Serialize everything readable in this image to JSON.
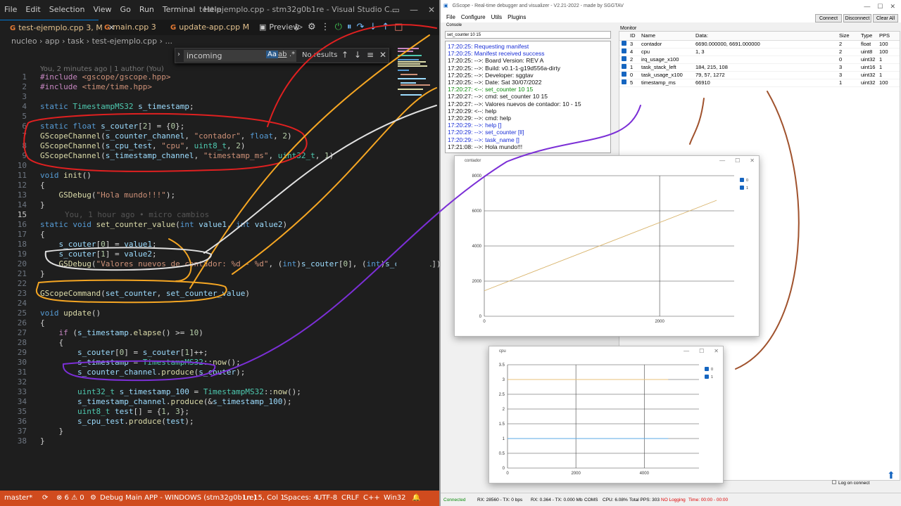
{
  "vscode": {
    "menu": [
      "File",
      "Edit",
      "Selection",
      "View",
      "Go",
      "Run",
      "Terminal",
      "Help"
    ],
    "title": "test-ejemplo.cpp - stm32g0b1re - Visual Studio C...",
    "tabs": [
      {
        "label": "test-ejemplo.cpp 3, M",
        "active": true
      },
      {
        "label": "main.cpp 3"
      },
      {
        "label": "update-app.cpp M"
      },
      {
        "label": "Preview"
      }
    ],
    "breadcrumb": "nucleo › app › task ›  test-ejemplo.cpp › ...",
    "find": {
      "query": "incoming",
      "opt_case": "Aa",
      "opt_word": "ab",
      "opt_regex": ".*",
      "result": "No results"
    },
    "blame_top": "You, 2 minutes ago | 1 author (You)",
    "blame_inline": "You, 1 hour ago • micro cambios",
    "status": {
      "branch": "master*",
      "errors": "⊗ 6 ⚠ 0",
      "debug": "Debug Main APP - WINDOWS (stm32g0b1re)",
      "position": "Ln 15, Col 1",
      "spaces": "Spaces: 4",
      "encoding": "UTF-8",
      "eol": "CRLF",
      "language": "C++",
      "platform": "Win32"
    }
  },
  "gscope": {
    "title": "GScope - Real-time debugger and visualizer - V2.21-2022 - made by SGGTAV",
    "menu": [
      "File",
      "Configure",
      "Utils",
      "Plugins"
    ],
    "buttons": {
      "connect": "Connect",
      "disconnect": "Disconnect",
      "clear": "Clear All"
    },
    "console_label": "Console",
    "command_value": "set_counter 10 15",
    "console_lines": [
      {
        "text": "17:20:25: Requesting manifest",
        "color": "blue"
      },
      {
        "text": "17:20:25: Manifest received success",
        "color": "blue"
      },
      {
        "text": "17:20:25: -->: Board Version: REV A",
        "color": "black"
      },
      {
        "text": "17:20:25: -->: Build: v0.1-1-g19d556a-dirty",
        "color": "black"
      },
      {
        "text": "17:20:25: -->: Developer: sggtav",
        "color": "black"
      },
      {
        "text": "17:20:25: -->: Date: Sat 30/07/2022",
        "color": "black"
      },
      {
        "text": "17:20:27: <--: set_counter 10 15",
        "color": "green"
      },
      {
        "text": "17:20:27: -->: cmd: set_counter 10 15",
        "color": "black"
      },
      {
        "text": "17:20:27: -->: Valores nuevos de contador: 10 - 15",
        "color": "black"
      },
      {
        "text": "17:20:29: <--: help",
        "color": "black"
      },
      {
        "text": "17:20:29: -->: cmd: help",
        "color": "black"
      },
      {
        "text": "17:20:29: -->: help []",
        "color": "blue"
      },
      {
        "text": "17:20:29: -->: set_counter [ll]",
        "color": "blue"
      },
      {
        "text": "17:20:29: -->: task_name []",
        "color": "blue"
      },
      {
        "text": "17:21:08: -->: Hola mundo!!!",
        "color": "black"
      }
    ],
    "monitor_label": "Monitor",
    "monitor_headers": [
      "ID",
      "Name",
      "Data:",
      "Size",
      "Type",
      "PPS"
    ],
    "monitor_rows": [
      {
        "id": "3",
        "name": "contador",
        "data": "6690.000000, 6691.000000",
        "size": "2",
        "type": "float",
        "pps": "100"
      },
      {
        "id": "4",
        "name": "cpu",
        "data": "1, 3",
        "size": "2",
        "type": "uint8",
        "pps": "100"
      },
      {
        "id": "2",
        "name": "irq_usage_x100",
        "data": "",
        "size": "0",
        "type": "uint32",
        "pps": "1"
      },
      {
        "id": "1",
        "name": "task_stack_left",
        "data": "184, 215, 108",
        "size": "3",
        "type": "uint16",
        "pps": "1"
      },
      {
        "id": "0",
        "name": "task_usage_x100",
        "data": "79, 57, 1272",
        "size": "3",
        "type": "uint32",
        "pps": "1"
      },
      {
        "id": "5",
        "name": "timestamp_ms",
        "data": "66910",
        "size": "1",
        "type": "uint32",
        "pps": "100"
      }
    ],
    "log_on_connect": "Log on connect",
    "status": {
      "connected": "Connected",
      "rx_tx": "RX: 28560 - TX: 0 bps",
      "rx_tx_mb": "RX: 0.364 - TX: 0.000 Mb",
      "port": "COMS",
      "cpu": "CPU: 6.08%",
      "pps": "Total PPS: 303",
      "logging": "NO Logging",
      "time": "Time: 00:00 - 00:00"
    }
  },
  "chart_data": [
    {
      "type": "line",
      "title": "contador",
      "x": [
        0,
        2650
      ],
      "series": [
        {
          "name": "0",
          "values": [
            1450,
            6600
          ]
        }
      ],
      "legend": [
        "0",
        "1"
      ],
      "xlim": [
        0,
        2850
      ],
      "ylim": [
        0,
        8000
      ],
      "xticks": [
        0,
        2000,
        4000
      ],
      "yticks": [
        0,
        2000,
        4000,
        6000,
        8000
      ],
      "grid": true,
      "legend_position": "right"
    },
    {
      "type": "line",
      "title": "cpu",
      "x": [
        0,
        4700
      ],
      "series": [
        {
          "name": "0",
          "values": [
            3,
            3
          ]
        },
        {
          "name": "1",
          "values": [
            1,
            1
          ]
        }
      ],
      "legend": [
        "0",
        "1"
      ],
      "xlim": [
        0,
        5600
      ],
      "ylim": [
        0,
        3.5
      ],
      "xticks": [
        0,
        2000,
        4000
      ],
      "yticks": [
        0,
        0.5,
        1,
        1.5,
        2,
        2.5,
        3,
        3.5
      ],
      "grid": true,
      "legend_position": "right"
    }
  ],
  "colors": {
    "vscode_status": "#d04b1e",
    "annot_red": "#e02020",
    "annot_orange": "#f5a623",
    "annot_white": "#e0e0e0",
    "annot_purple": "#7b2fd6",
    "annot_brown": "#a0522d"
  }
}
